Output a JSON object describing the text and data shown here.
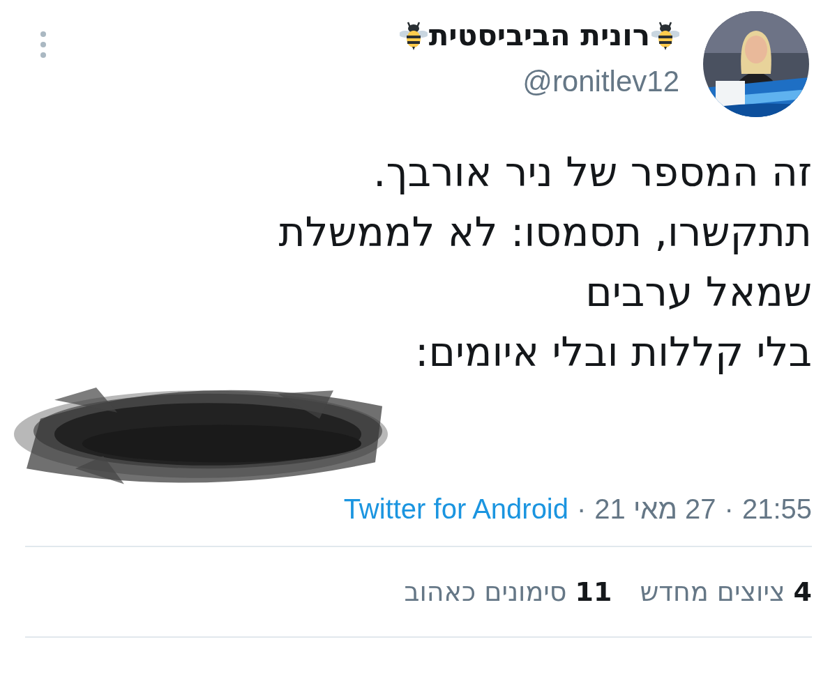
{
  "author": {
    "name": "רונית הביביסטית",
    "handle": "@ronitlev12"
  },
  "body": [
    "זה המספר של ניר אורבך.",
    "תתקשרו, תסמסו: לא לממשלת",
    "שמאל ערבים",
    "בלי קללות ובלי איומים:"
  ],
  "meta": {
    "time": "21:55",
    "date": "27 מאי 21",
    "source": "Twitter for Android",
    "separator": "·"
  },
  "stats": [
    {
      "count": "4",
      "label": "ציוצים מחדש"
    },
    {
      "count": "11",
      "label": "סימונים כאהוב"
    }
  ]
}
